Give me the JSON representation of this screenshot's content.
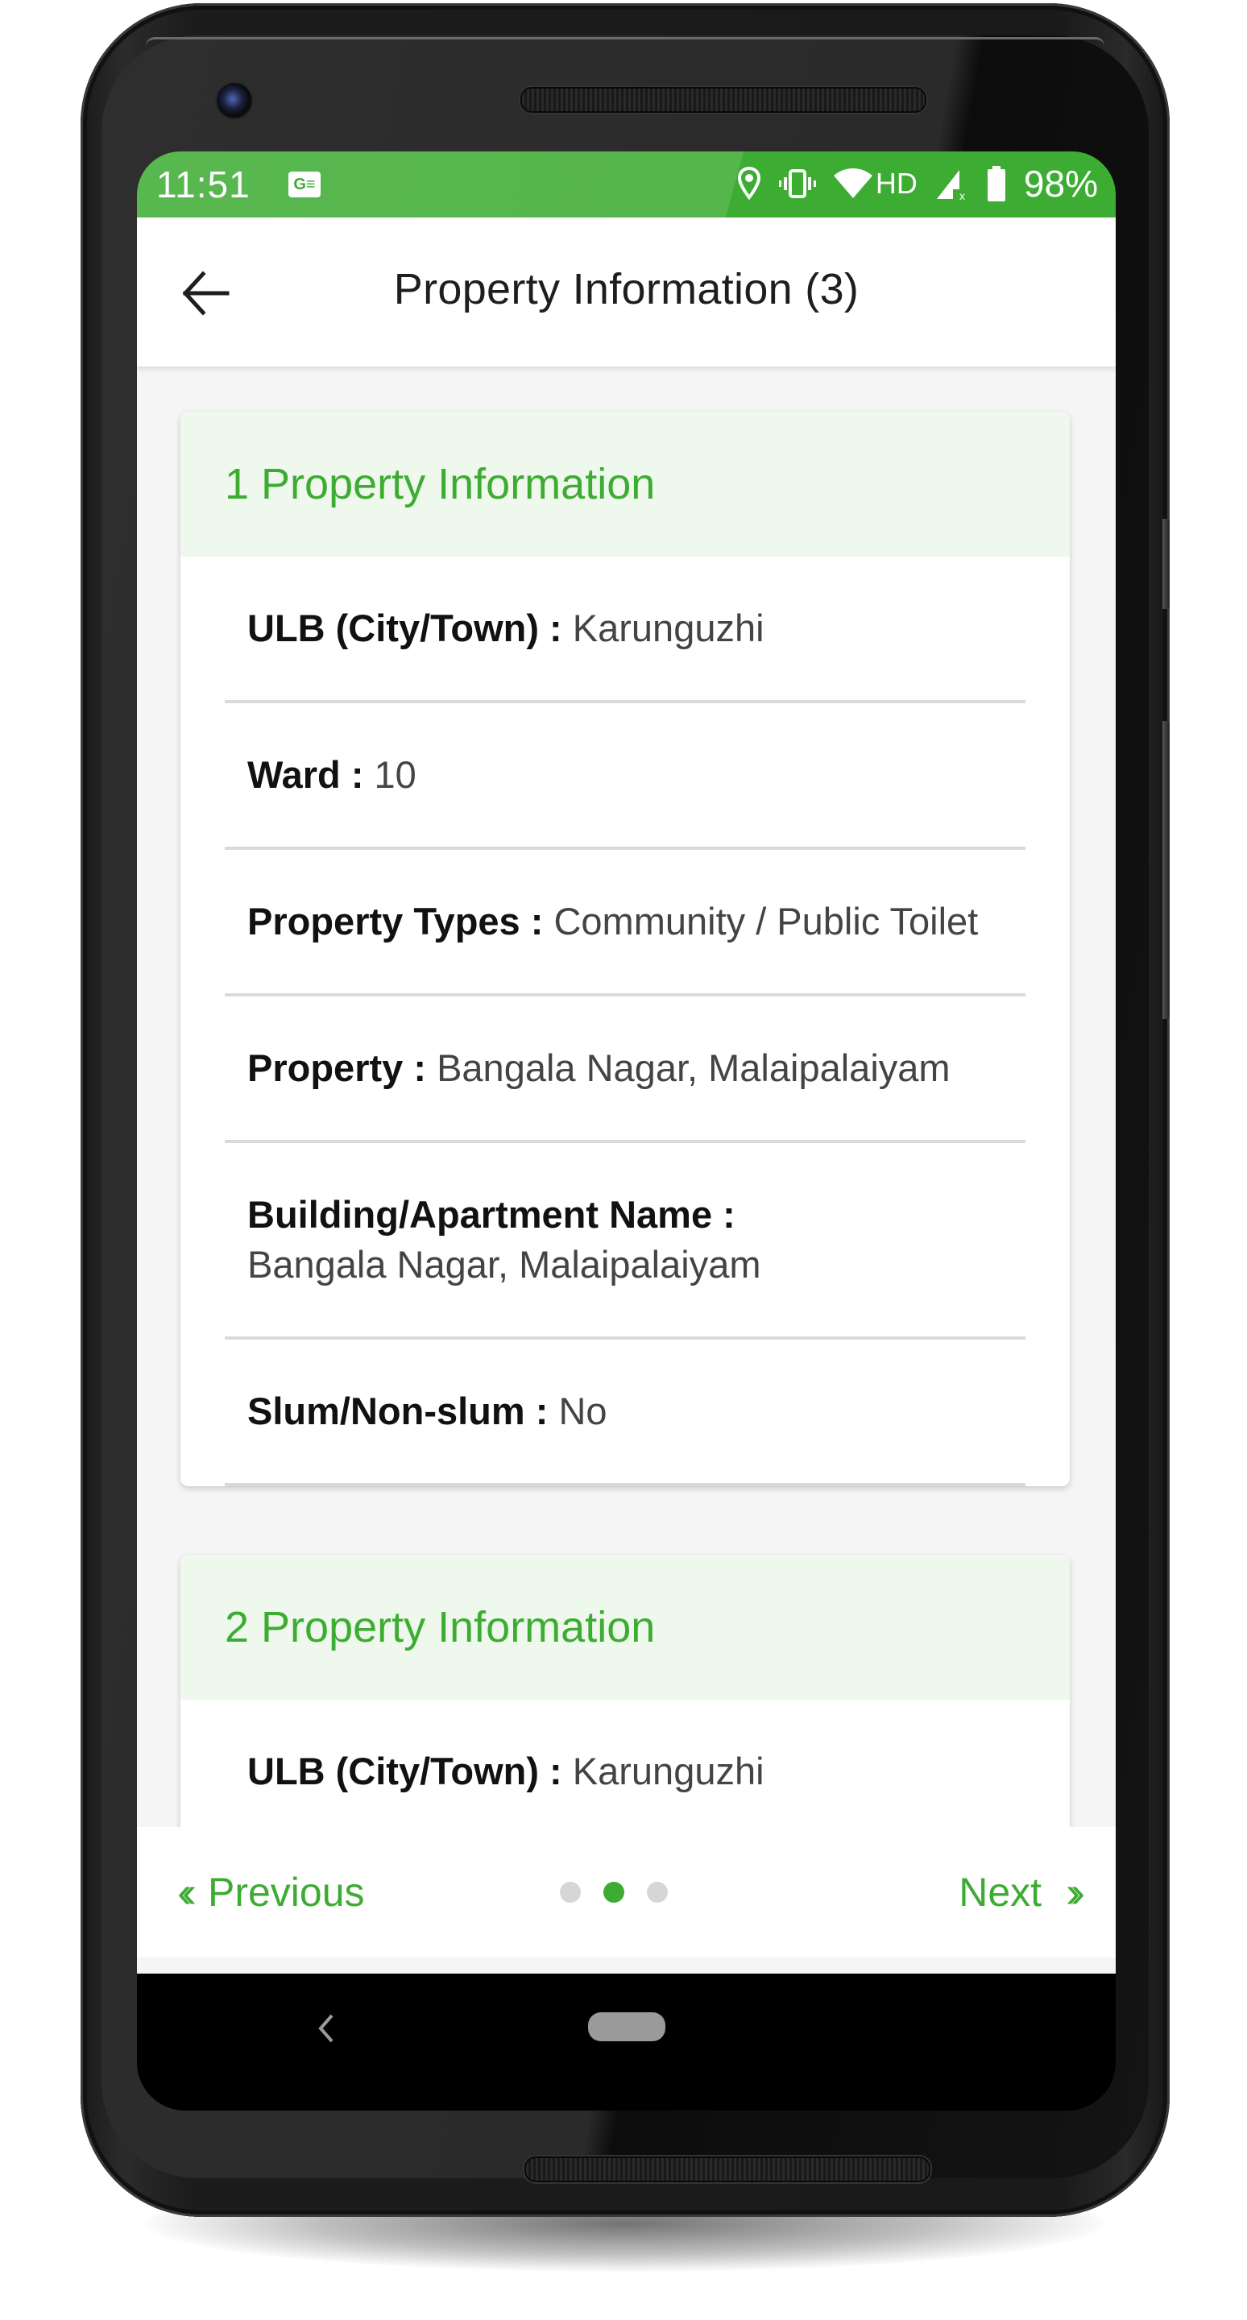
{
  "status_bar": {
    "time": "11:51",
    "notification_icon": "news-icon",
    "icons": [
      "location-icon",
      "vibrate-icon",
      "wifi-icon",
      "signal-icon",
      "battery-icon"
    ],
    "network_label": "HD",
    "battery_percent": "98%",
    "color": "#3dac33"
  },
  "app_bar": {
    "back_icon": "arrow-left-icon",
    "title": "Property Information (3)"
  },
  "cards": [
    {
      "title": "1 Property Information",
      "rows": [
        {
          "label": "ULB (City/Town) :",
          "value": "Karunguzhi"
        },
        {
          "label": "Ward :",
          "value": "10"
        },
        {
          "label": "Property Types :",
          "value": "Community / Public Toilet"
        },
        {
          "label": "Property :",
          "value": "Bangala Nagar, Malaipalaiyam"
        },
        {
          "label": "Building/Apartment Name :",
          "value": "Bangala Nagar, Malaipalaiyam"
        },
        {
          "label": "Slum/Non-slum :",
          "value": "No"
        }
      ]
    },
    {
      "title": "2 Property Information",
      "rows": [
        {
          "label": "ULB (City/Town) :",
          "value": "Karunguzhi"
        }
      ]
    }
  ],
  "pager": {
    "previous_label": "Previous",
    "next_label": "Next",
    "previous_icon": "double-chevron-left-icon",
    "next_icon": "double-chevron-right-icon",
    "page_count": 3,
    "current_page": 2,
    "accent_color": "#3dac33"
  },
  "system_nav": {
    "back_icon": "system-back-icon",
    "home_icon": "home-pill-icon"
  }
}
